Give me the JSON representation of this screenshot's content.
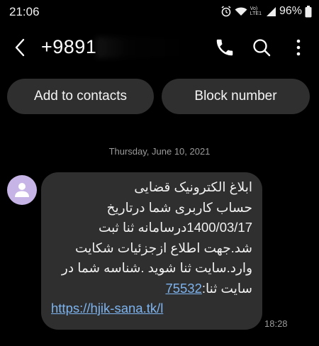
{
  "status": {
    "time": "21:06",
    "volte_top": "Vo)",
    "volte_bottom": "LTE1",
    "battery": "96%"
  },
  "header": {
    "back_icon": "chevron-left-icon",
    "number": "+9891",
    "call_icon": "phone-icon",
    "search_icon": "search-icon",
    "more_icon": "more-vertical-icon"
  },
  "actions": {
    "add_label": "Add to contacts",
    "block_label": "Block number"
  },
  "conversation": {
    "date": "Thursday, June 10, 2021",
    "message": {
      "line1": "ابلاغ الکترونیک قضایی",
      "line2": "حساب کاربری شما درتاریخ",
      "line3": "1400/03/17درسامانه ثنا ثبت",
      "line4": "شد.جهت اطلاع ازجزئیات شکایت",
      "line5": "وارد.سایت ثنا شوید .شناسه شما در",
      "line6_prefix": "سایت ثنا:",
      "code": "75532",
      "link": "https://hjik-sana.tk/l",
      "time": "18:28"
    }
  },
  "colors": {
    "background": "#000000",
    "bubble": "#2f2f2f",
    "link": "#7db4f0",
    "avatar": "#c7b4e6"
  }
}
